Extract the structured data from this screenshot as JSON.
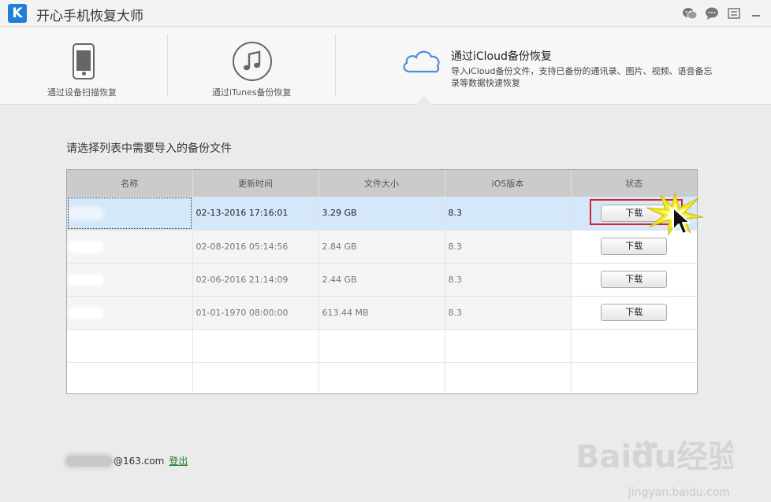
{
  "app": {
    "logo_letter": "K",
    "title": "开心手机恢复大师"
  },
  "modes": {
    "device": {
      "label": "通过设备扫描恢复"
    },
    "itunes": {
      "label": "通过iTunes备份恢复"
    },
    "icloud": {
      "title": "通过iCloud备份恢复",
      "description": "导入iCloud备份文件，支持已备份的通讯录、图片、视频、语音备忘录等数据快速恢复"
    },
    "active": "icloud"
  },
  "content": {
    "prompt": "请选择列表中需要导入的备份文件",
    "table": {
      "headers": [
        "名称",
        "更新时间",
        "文件大小",
        "iOS版本",
        "状态"
      ],
      "rows": [
        {
          "name": "",
          "updated": "02-13-2016 17:16:01",
          "size": "3.29 GB",
          "ios": "8.3",
          "action": "下载",
          "selected": true
        },
        {
          "name": "",
          "updated": "02-08-2016 05:14:56",
          "size": "2.84 GB",
          "ios": "8.3",
          "action": "下载",
          "selected": false
        },
        {
          "name": "",
          "updated": "02-06-2016 21:14:09",
          "size": "2.44 GB",
          "ios": "8.3",
          "action": "下载",
          "selected": false
        },
        {
          "name": "",
          "updated": "01-01-1970 08:00:00",
          "size": "613.44 MB",
          "ios": "8.3",
          "action": "下载",
          "selected": false
        }
      ]
    }
  },
  "footer": {
    "account_suffix": "@163.com",
    "logout_label": "登出"
  },
  "watermark": {
    "brand": "Baidu经验",
    "url": "jingyan.baidu.com"
  },
  "colors": {
    "accent_blue": "#1f7fd6",
    "selected_row": "#d5e8f9",
    "highlight_red": "#d8222a",
    "logout_green": "#1a7a2a"
  },
  "icons": [
    "wechat-icon",
    "chat-icon",
    "menu-icon",
    "minimize-icon",
    "phone-icon",
    "music-icon",
    "cloud-icon",
    "cursor-icon"
  ]
}
